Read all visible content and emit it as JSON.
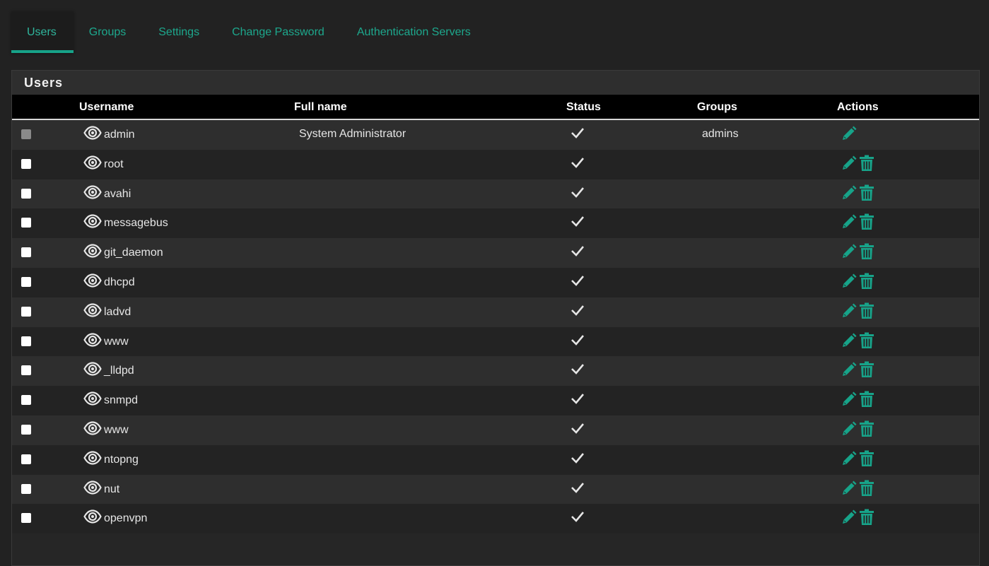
{
  "tabs": [
    {
      "label": "Users",
      "active": true
    },
    {
      "label": "Groups",
      "active": false
    },
    {
      "label": "Settings",
      "active": false
    },
    {
      "label": "Change Password",
      "active": false
    },
    {
      "label": "Authentication Servers",
      "active": false
    }
  ],
  "panel": {
    "title": "Users",
    "columns": {
      "username": "Username",
      "fullname": "Full name",
      "status": "Status",
      "groups": "Groups",
      "actions": "Actions"
    }
  },
  "users": [
    {
      "username": "admin",
      "fullname": "System Administrator",
      "groups": "admins",
      "enabled": true,
      "deletable": false,
      "selectable": false
    },
    {
      "username": "root",
      "fullname": "",
      "groups": "",
      "enabled": true,
      "deletable": true,
      "selectable": true
    },
    {
      "username": "avahi",
      "fullname": "",
      "groups": "",
      "enabled": true,
      "deletable": true,
      "selectable": true
    },
    {
      "username": "messagebus",
      "fullname": "",
      "groups": "",
      "enabled": true,
      "deletable": true,
      "selectable": true
    },
    {
      "username": "git_daemon",
      "fullname": "",
      "groups": "",
      "enabled": true,
      "deletable": true,
      "selectable": true
    },
    {
      "username": "dhcpd",
      "fullname": "",
      "groups": "",
      "enabled": true,
      "deletable": true,
      "selectable": true
    },
    {
      "username": "ladvd",
      "fullname": "",
      "groups": "",
      "enabled": true,
      "deletable": true,
      "selectable": true
    },
    {
      "username": "www",
      "fullname": "",
      "groups": "",
      "enabled": true,
      "deletable": true,
      "selectable": true
    },
    {
      "username": "_lldpd",
      "fullname": "",
      "groups": "",
      "enabled": true,
      "deletable": true,
      "selectable": true
    },
    {
      "username": "snmpd",
      "fullname": "",
      "groups": "",
      "enabled": true,
      "deletable": true,
      "selectable": true
    },
    {
      "username": "www",
      "fullname": "",
      "groups": "",
      "enabled": true,
      "deletable": true,
      "selectable": true
    },
    {
      "username": "ntopng",
      "fullname": "",
      "groups": "",
      "enabled": true,
      "deletable": true,
      "selectable": true
    },
    {
      "username": "nut",
      "fullname": "",
      "groups": "",
      "enabled": true,
      "deletable": true,
      "selectable": true
    },
    {
      "username": "openvpn",
      "fullname": "",
      "groups": "",
      "enabled": true,
      "deletable": true,
      "selectable": true
    }
  ],
  "icons": {
    "view": "eye-icon",
    "status": "check-icon",
    "edit": "pencil-icon",
    "delete": "trash-icon"
  },
  "colors": {
    "accent": "#17a389",
    "background": "#222222",
    "header_bg": "#000000"
  }
}
